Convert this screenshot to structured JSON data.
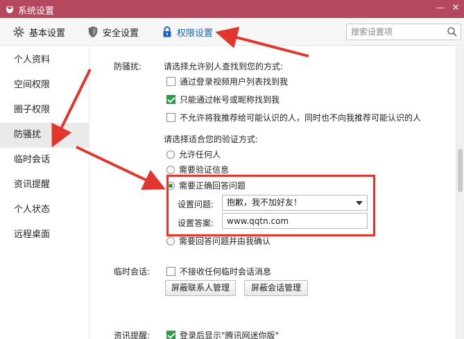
{
  "window": {
    "title": "系统设置",
    "minimize_glyph": "—",
    "close_glyph": "✕",
    "accent": "#b5485e"
  },
  "toolbar": {
    "tabs": [
      {
        "label": "基本设置",
        "icon": "gear-icon"
      },
      {
        "label": "安全设置",
        "icon": "shield-icon"
      },
      {
        "label": "权限设置",
        "icon": "lock-icon",
        "active": true
      }
    ],
    "search_placeholder": "搜索设置项",
    "active_color": "#1a66c2"
  },
  "sidebar": {
    "items": [
      {
        "label": "个人资料"
      },
      {
        "label": "空间权限"
      },
      {
        "label": "圈子权限"
      },
      {
        "label": "防骚扰",
        "active": true
      },
      {
        "label": "临时会话"
      },
      {
        "label": "资讯提醒"
      },
      {
        "label": "个人状态"
      },
      {
        "label": "远程桌面"
      }
    ]
  },
  "anti_harass": {
    "section_label": "防骚扰:",
    "find_prompt": "请选择允许别人查找到您的方式:",
    "find_options": [
      {
        "label": "通过登录视频用户列表找到我",
        "checked": false
      },
      {
        "label": "只能通过帐号或昵称找到我",
        "checked": true
      },
      {
        "label": "不允许将我推荐给可能认识的人，同时也不向我推荐可能认识的人",
        "checked": false
      }
    ],
    "verify_prompt": "请选择适合您的验证方式:",
    "verify_options": [
      {
        "label": "允许任何人",
        "selected": false
      },
      {
        "label": "需要验证信息",
        "selected": false
      },
      {
        "label": "需要正确回答问题",
        "selected": true
      },
      {
        "label": "需要回答问题并由我确认",
        "selected": false
      }
    ],
    "question_label": "设置问题:",
    "question_value": "抱歉，我不加好友！",
    "answer_label": "设置答案:",
    "answer_value": "www.qqtn.com"
  },
  "temp_session": {
    "section_label": "临时会话:",
    "option": {
      "label": "不接收任何临时会话消息",
      "checked": false
    },
    "buttons": [
      "屏蔽联系人管理",
      "屏蔽会话管理"
    ]
  },
  "news": {
    "section_label": "资讯提醒:",
    "option": {
      "label": "登录后显示\"腾讯网迷你版\"",
      "checked": true
    }
  },
  "annotation_color": "#e2352e",
  "check_color": "#2d9a46"
}
